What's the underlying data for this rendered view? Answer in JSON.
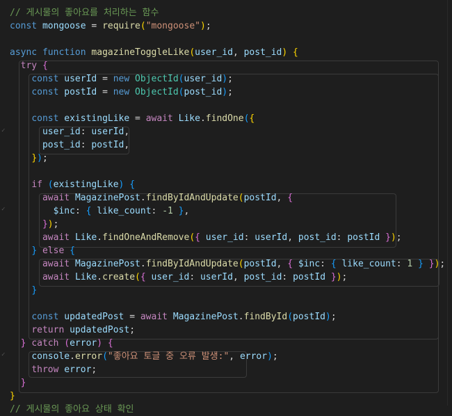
{
  "editor": {
    "lines": [
      [
        {
          "t": "// 게시물의 좋아요를 처리하는 함수",
          "c": "comment"
        }
      ],
      [
        {
          "t": "const",
          "c": "keyword"
        },
        {
          "t": " "
        },
        {
          "t": "mongoose",
          "c": "var"
        },
        {
          "t": " = "
        },
        {
          "t": "require",
          "c": "func"
        },
        {
          "t": "(",
          "c": "brace1"
        },
        {
          "t": "\"mongoose\"",
          "c": "string"
        },
        {
          "t": ")",
          "c": "brace1"
        },
        {
          "t": ";"
        }
      ],
      [],
      [
        {
          "t": "async",
          "c": "keyword"
        },
        {
          "t": " "
        },
        {
          "t": "function",
          "c": "keyword"
        },
        {
          "t": " "
        },
        {
          "t": "magazineToggleLike",
          "c": "func"
        },
        {
          "t": "(",
          "c": "brace1"
        },
        {
          "t": "user_id",
          "c": "var"
        },
        {
          "t": ", "
        },
        {
          "t": "post_id",
          "c": "var"
        },
        {
          "t": ")",
          "c": "brace1"
        },
        {
          "t": " "
        },
        {
          "t": "{",
          "c": "brace1"
        }
      ],
      [
        {
          "t": "  "
        },
        {
          "t": "try",
          "c": "control"
        },
        {
          "t": " "
        },
        {
          "t": "{",
          "c": "brace2"
        }
      ],
      [
        {
          "t": "    "
        },
        {
          "t": "const",
          "c": "keyword"
        },
        {
          "t": " "
        },
        {
          "t": "userId",
          "c": "var"
        },
        {
          "t": " = "
        },
        {
          "t": "new",
          "c": "keyword"
        },
        {
          "t": " "
        },
        {
          "t": "ObjectId",
          "c": "type"
        },
        {
          "t": "(",
          "c": "brace3"
        },
        {
          "t": "user_id",
          "c": "var"
        },
        {
          "t": ")",
          "c": "brace3"
        },
        {
          "t": ";"
        }
      ],
      [
        {
          "t": "    "
        },
        {
          "t": "const",
          "c": "keyword"
        },
        {
          "t": " "
        },
        {
          "t": "postId",
          "c": "var"
        },
        {
          "t": " = "
        },
        {
          "t": "new",
          "c": "keyword"
        },
        {
          "t": " "
        },
        {
          "t": "ObjectId",
          "c": "type"
        },
        {
          "t": "(",
          "c": "brace3"
        },
        {
          "t": "post_id",
          "c": "var"
        },
        {
          "t": ")",
          "c": "brace3"
        },
        {
          "t": ";"
        }
      ],
      [],
      [
        {
          "t": "    "
        },
        {
          "t": "const",
          "c": "keyword"
        },
        {
          "t": " "
        },
        {
          "t": "existingLike",
          "c": "var"
        },
        {
          "t": " = "
        },
        {
          "t": "await",
          "c": "control"
        },
        {
          "t": " "
        },
        {
          "t": "Like",
          "c": "var"
        },
        {
          "t": "."
        },
        {
          "t": "findOne",
          "c": "func"
        },
        {
          "t": "(",
          "c": "brace3"
        },
        {
          "t": "{",
          "c": "brace1"
        }
      ],
      [
        {
          "t": "      "
        },
        {
          "t": "user_id",
          "c": "var"
        },
        {
          "t": ": "
        },
        {
          "t": "userId",
          "c": "var"
        },
        {
          "t": ","
        }
      ],
      [
        {
          "t": "      "
        },
        {
          "t": "post_id",
          "c": "var"
        },
        {
          "t": ": "
        },
        {
          "t": "postId",
          "c": "var"
        },
        {
          "t": ","
        }
      ],
      [
        {
          "t": "    "
        },
        {
          "t": "}",
          "c": "brace1"
        },
        {
          "t": ")",
          "c": "brace3"
        },
        {
          "t": ";"
        }
      ],
      [],
      [
        {
          "t": "    "
        },
        {
          "t": "if",
          "c": "control"
        },
        {
          "t": " "
        },
        {
          "t": "(",
          "c": "brace3"
        },
        {
          "t": "existingLike",
          "c": "var"
        },
        {
          "t": ")",
          "c": "brace3"
        },
        {
          "t": " "
        },
        {
          "t": "{",
          "c": "brace3"
        }
      ],
      [
        {
          "t": "      "
        },
        {
          "t": "await",
          "c": "control"
        },
        {
          "t": " "
        },
        {
          "t": "MagazinePost",
          "c": "var"
        },
        {
          "t": "."
        },
        {
          "t": "findByIdAndUpdate",
          "c": "func"
        },
        {
          "t": "(",
          "c": "brace1"
        },
        {
          "t": "postId",
          "c": "var"
        },
        {
          "t": ", "
        },
        {
          "t": "{",
          "c": "brace2"
        }
      ],
      [
        {
          "t": "        "
        },
        {
          "t": "$inc",
          "c": "var"
        },
        {
          "t": ": "
        },
        {
          "t": "{",
          "c": "brace3"
        },
        {
          "t": " "
        },
        {
          "t": "like_count",
          "c": "var"
        },
        {
          "t": ": "
        },
        {
          "t": "-1",
          "c": "number"
        },
        {
          "t": " "
        },
        {
          "t": "}",
          "c": "brace3"
        },
        {
          "t": ","
        }
      ],
      [
        {
          "t": "      "
        },
        {
          "t": "}",
          "c": "brace2"
        },
        {
          "t": ")",
          "c": "brace1"
        },
        {
          "t": ";"
        }
      ],
      [
        {
          "t": "      "
        },
        {
          "t": "await",
          "c": "control"
        },
        {
          "t": " "
        },
        {
          "t": "Like",
          "c": "var"
        },
        {
          "t": "."
        },
        {
          "t": "findOneAndRemove",
          "c": "func"
        },
        {
          "t": "(",
          "c": "brace1"
        },
        {
          "t": "{",
          "c": "brace2"
        },
        {
          "t": " "
        },
        {
          "t": "user_id",
          "c": "var"
        },
        {
          "t": ": "
        },
        {
          "t": "userId",
          "c": "var"
        },
        {
          "t": ", "
        },
        {
          "t": "post_id",
          "c": "var"
        },
        {
          "t": ": "
        },
        {
          "t": "postId",
          "c": "var"
        },
        {
          "t": " "
        },
        {
          "t": "}",
          "c": "brace2"
        },
        {
          "t": ")",
          "c": "brace1"
        },
        {
          "t": ";"
        }
      ],
      [
        {
          "t": "    "
        },
        {
          "t": "}",
          "c": "brace3"
        },
        {
          "t": " "
        },
        {
          "t": "else",
          "c": "control"
        },
        {
          "t": " "
        },
        {
          "t": "{",
          "c": "brace3"
        }
      ],
      [
        {
          "t": "      "
        },
        {
          "t": "await",
          "c": "control"
        },
        {
          "t": " "
        },
        {
          "t": "MagazinePost",
          "c": "var"
        },
        {
          "t": "."
        },
        {
          "t": "findByIdAndUpdate",
          "c": "func"
        },
        {
          "t": "(",
          "c": "brace1"
        },
        {
          "t": "postId",
          "c": "var"
        },
        {
          "t": ", "
        },
        {
          "t": "{",
          "c": "brace2"
        },
        {
          "t": " "
        },
        {
          "t": "$inc",
          "c": "var"
        },
        {
          "t": ": "
        },
        {
          "t": "{",
          "c": "brace3"
        },
        {
          "t": " "
        },
        {
          "t": "like_count",
          "c": "var"
        },
        {
          "t": ": "
        },
        {
          "t": "1",
          "c": "number"
        },
        {
          "t": " "
        },
        {
          "t": "}",
          "c": "brace3"
        },
        {
          "t": " "
        },
        {
          "t": "}",
          "c": "brace2"
        },
        {
          "t": ")",
          "c": "brace1"
        },
        {
          "t": ";"
        }
      ],
      [
        {
          "t": "      "
        },
        {
          "t": "await",
          "c": "control"
        },
        {
          "t": " "
        },
        {
          "t": "Like",
          "c": "var"
        },
        {
          "t": "."
        },
        {
          "t": "create",
          "c": "func"
        },
        {
          "t": "(",
          "c": "brace1"
        },
        {
          "t": "{",
          "c": "brace2"
        },
        {
          "t": " "
        },
        {
          "t": "user_id",
          "c": "var"
        },
        {
          "t": ": "
        },
        {
          "t": "userId",
          "c": "var"
        },
        {
          "t": ", "
        },
        {
          "t": "post_id",
          "c": "var"
        },
        {
          "t": ": "
        },
        {
          "t": "postId",
          "c": "var"
        },
        {
          "t": " "
        },
        {
          "t": "}",
          "c": "brace2"
        },
        {
          "t": ")",
          "c": "brace1"
        },
        {
          "t": ";"
        }
      ],
      [
        {
          "t": "    "
        },
        {
          "t": "}",
          "c": "brace3"
        }
      ],
      [],
      [
        {
          "t": "    "
        },
        {
          "t": "const",
          "c": "keyword"
        },
        {
          "t": " "
        },
        {
          "t": "updatedPost",
          "c": "var"
        },
        {
          "t": " = "
        },
        {
          "t": "await",
          "c": "control"
        },
        {
          "t": " "
        },
        {
          "t": "MagazinePost",
          "c": "var"
        },
        {
          "t": "."
        },
        {
          "t": "findById",
          "c": "func"
        },
        {
          "t": "(",
          "c": "brace3"
        },
        {
          "t": "postId",
          "c": "var"
        },
        {
          "t": ")",
          "c": "brace3"
        },
        {
          "t": ";"
        }
      ],
      [
        {
          "t": "    "
        },
        {
          "t": "return",
          "c": "control"
        },
        {
          "t": " "
        },
        {
          "t": "updatedPost",
          "c": "var"
        },
        {
          "t": ";"
        }
      ],
      [
        {
          "t": "  "
        },
        {
          "t": "}",
          "c": "brace2"
        },
        {
          "t": " "
        },
        {
          "t": "catch",
          "c": "control"
        },
        {
          "t": " "
        },
        {
          "t": "(",
          "c": "brace2"
        },
        {
          "t": "error",
          "c": "var"
        },
        {
          "t": ")",
          "c": "brace2"
        },
        {
          "t": " "
        },
        {
          "t": "{",
          "c": "brace2"
        }
      ],
      [
        {
          "t": "    "
        },
        {
          "t": "console",
          "c": "var"
        },
        {
          "t": "."
        },
        {
          "t": "error",
          "c": "func"
        },
        {
          "t": "(",
          "c": "brace3"
        },
        {
          "t": "\"좋아요 토글 중 오류 발생:\"",
          "c": "string"
        },
        {
          "t": ", "
        },
        {
          "t": "error",
          "c": "var"
        },
        {
          "t": ")",
          "c": "brace3"
        },
        {
          "t": ";"
        }
      ],
      [
        {
          "t": "    "
        },
        {
          "t": "throw",
          "c": "control"
        },
        {
          "t": " "
        },
        {
          "t": "error",
          "c": "var"
        },
        {
          "t": ";"
        }
      ],
      [
        {
          "t": "  "
        },
        {
          "t": "}",
          "c": "brace2"
        }
      ],
      [
        {
          "t": "}",
          "c": "brace1"
        }
      ],
      [
        {
          "t": "// 게시물의 좋아요 상태 확인",
          "c": "comment"
        }
      ]
    ]
  },
  "colors": {
    "background": "#1e1e1e",
    "comment": "#6a9955",
    "keyword": "#569cd6",
    "control": "#c586c0",
    "function": "#dcdcaa",
    "variable": "#9cdcfe",
    "type": "#4ec9b0",
    "string": "#ce9178",
    "number": "#b5cea8"
  }
}
